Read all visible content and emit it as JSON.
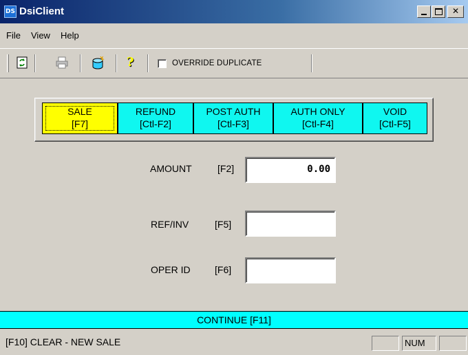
{
  "window": {
    "title": "DsiClient",
    "icon_text": "DS"
  },
  "menu": [
    "File",
    "View",
    "Help"
  ],
  "toolbar": {
    "buttons": [
      "refresh-icon",
      "print-icon",
      "database-icon",
      "help-icon"
    ],
    "override_label": "OVERRIDE DUPLICATE",
    "override_checked": false
  },
  "modes": [
    {
      "label": "SALE",
      "key": "[F7]",
      "active": true
    },
    {
      "label": "REFUND",
      "key": "[Ctl-F2]",
      "active": false
    },
    {
      "label": "POST AUTH",
      "key": "[Ctl-F3]",
      "active": false
    },
    {
      "label": "AUTH ONLY",
      "key": "[Ctl-F4]",
      "active": false
    },
    {
      "label": "VOID",
      "key": "[Ctl-F5]",
      "active": false
    }
  ],
  "fields": {
    "amount": {
      "label": "AMOUNT",
      "key": "[F2]",
      "value": "0.00"
    },
    "refinv": {
      "label": "REF/INV",
      "key": "[F5]",
      "value": ""
    },
    "operid": {
      "label": "OPER ID",
      "key": "[F6]",
      "value": ""
    }
  },
  "continue_label": "CONTINUE [F11]",
  "status": {
    "text": "[F10] CLEAR - NEW SALE",
    "num": "NUM"
  },
  "colors": {
    "mode_button": "#00ffff",
    "active_mode": "#ffff00",
    "continue_bar": "#00ffff"
  }
}
